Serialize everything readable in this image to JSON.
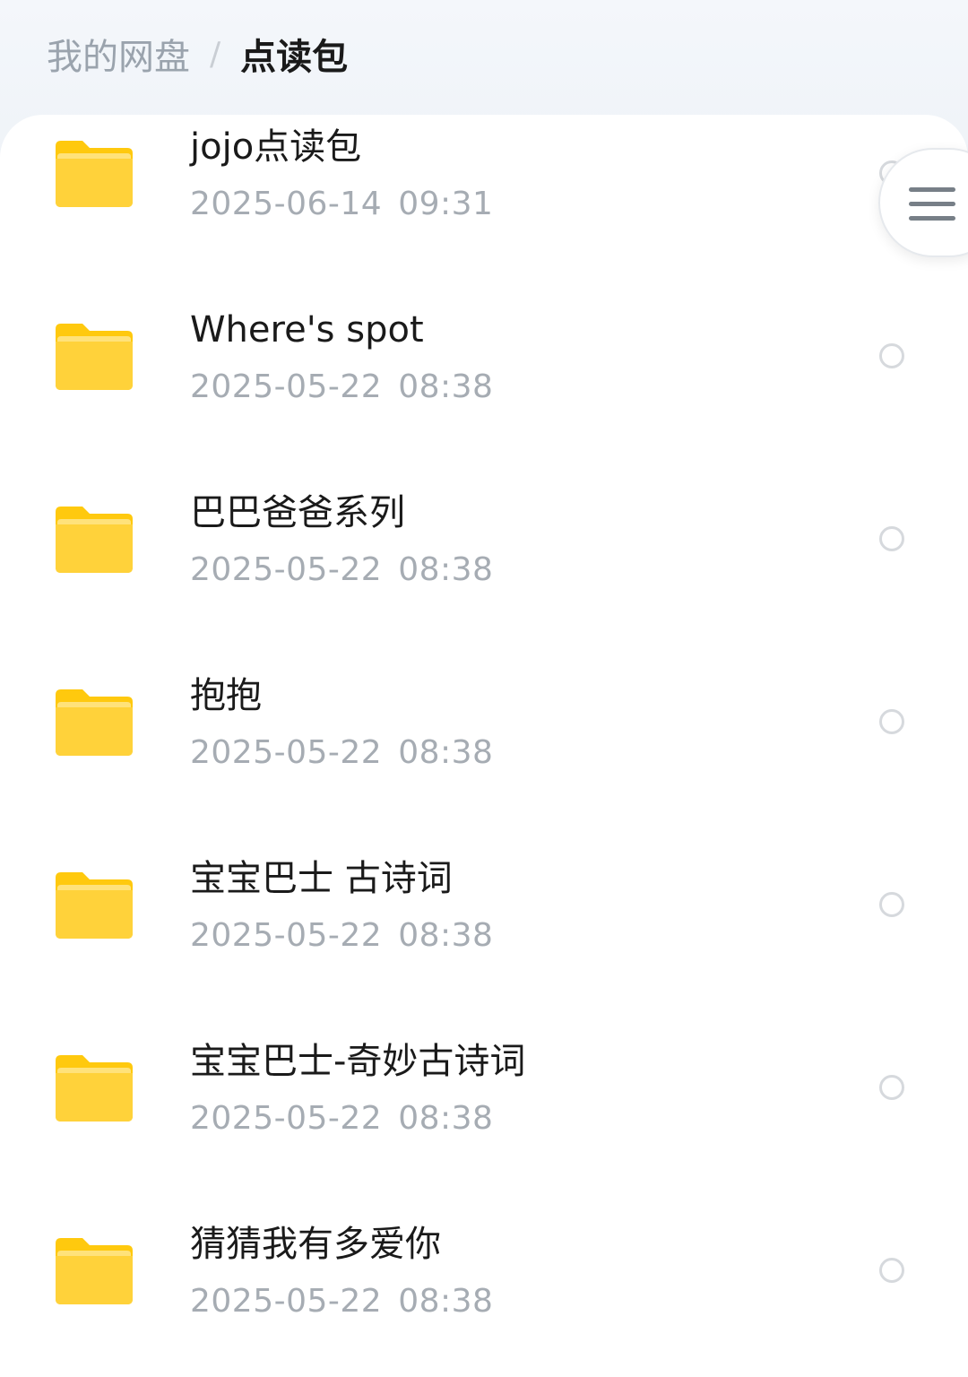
{
  "breadcrumb": {
    "parent": "我的网盘",
    "separator": "/",
    "current": "点读包"
  },
  "menu_button": {
    "icon": "hamburger-menu-icon"
  },
  "files": [
    {
      "name": "jojo点读包",
      "date": "2025-06-14",
      "time": "09:31",
      "type": "folder"
    },
    {
      "name": "Where's spot",
      "date": "2025-05-22",
      "time": "08:38",
      "type": "folder"
    },
    {
      "name": "巴巴爸爸系列",
      "date": "2025-05-22",
      "time": "08:38",
      "type": "folder"
    },
    {
      "name": "抱抱",
      "date": "2025-05-22",
      "time": "08:38",
      "type": "folder"
    },
    {
      "name": "宝宝巴士 古诗词",
      "date": "2025-05-22",
      "time": "08:38",
      "type": "folder"
    },
    {
      "name": "宝宝巴士-奇妙古诗词",
      "date": "2025-05-22",
      "time": "08:38",
      "type": "folder"
    },
    {
      "name": "猜猜我有多爱你",
      "date": "2025-05-22",
      "time": "08:38",
      "type": "folder"
    }
  ],
  "colors": {
    "folder_yellow": "#FFC90E",
    "folder_light": "#FFE27A",
    "text_primary": "#1A1A1A",
    "text_secondary": "#A6ACB3"
  }
}
